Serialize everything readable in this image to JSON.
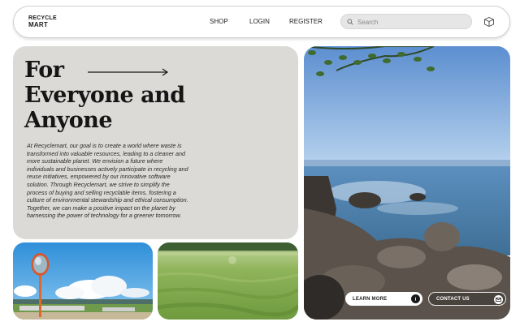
{
  "header": {
    "logo_line1": "RECYCLE",
    "logo_line2": "MART",
    "nav": {
      "shop": "SHOP",
      "login": "LOGIN",
      "register": "REGISTER"
    },
    "search_placeholder": "Search"
  },
  "hero": {
    "title_line1": "For",
    "title_line2": "Everyone and",
    "title_line3": "Anyone",
    "body": "At Recyclemart, our goal is to create a world where waste is transformed into valuable resources, leading to a cleaner and more sustainable planet. We envision a future where individuals and businesses actively participate in recycling and reuse initiatives, empowered by our innovative software solution. Through Recyclemart, we strive to simplify the process of buying and selling recyclable items, fostering a culture of environmental stewardship and ethical consumption. Together, we can make a positive impact on the planet by harnessing the power of technology for a greener tomorrow."
  },
  "actions": {
    "learn_more": "LEARN MORE",
    "contact_us": "CONTACT US"
  },
  "icons": {
    "search": "search-icon",
    "box": "box-icon",
    "arrow": "arrow-right-icon",
    "learn_more": "info-icon",
    "contact": "mail-icon"
  },
  "colors": {
    "hero_bg": "#dcdad7",
    "text": "#151515",
    "search_bg": "#e6e6e6"
  }
}
